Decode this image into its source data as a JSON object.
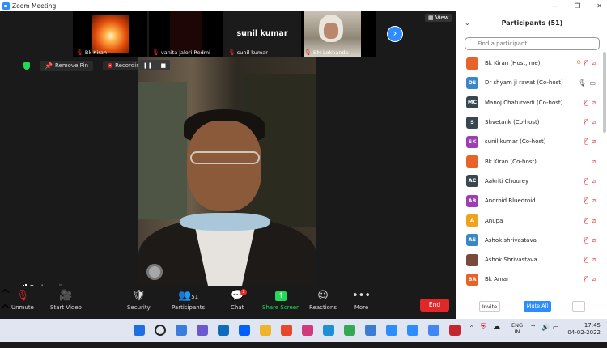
{
  "window": {
    "title": "Zoom Meeting",
    "controls": [
      "—",
      "❐",
      "✕"
    ]
  },
  "thumbnails": [
    {
      "name": "Bk Kiran"
    },
    {
      "name": "vanita jalori Redmi"
    },
    {
      "name": "sunil kumar",
      "display_name": "sunil kumar"
    },
    {
      "name": "BM Lokhande"
    }
  ],
  "view_label": "View",
  "next_arrow": "›",
  "top_left": {
    "remove_pin": "Remove Pin",
    "recording": "Recording..."
  },
  "pause_controls": {
    "pause": "❚❚",
    "stop": "■"
  },
  "active_speaker": "Dr shyam ji rawat",
  "toolbar": {
    "unmute": "Unmute",
    "start_video": "Start Video",
    "security": "Security",
    "participants": "Participants",
    "participants_count": "51",
    "chat": "Chat",
    "chat_badge": "2",
    "share_screen": "Share Screen",
    "reactions": "Reactions",
    "more": "More",
    "end": "End"
  },
  "panel": {
    "title": "Participants (51)",
    "search_placeholder": "Find a participant",
    "participants": [
      {
        "initials": "",
        "name": "Bk Kiran (Host, me)",
        "avatar_color": "#e8632a",
        "mic": "off",
        "cam": "off",
        "sharing": true
      },
      {
        "initials": "DS",
        "name": "Dr shyam ji rawat (Co-host)",
        "avatar_color": "#3a86c8",
        "mic": "on",
        "cam": "on"
      },
      {
        "initials": "MC",
        "name": "Manoj Chaturvedi (Co-host)",
        "avatar_color": "#37474f",
        "mic": "off",
        "cam": "off"
      },
      {
        "initials": "S",
        "name": "Shvetank (Co-host)",
        "avatar_color": "#37474f",
        "mic": "off",
        "cam": "off"
      },
      {
        "initials": "SK",
        "name": "sunil kumar (Co-host)",
        "avatar_color": "#9c3fb5",
        "mic": "off",
        "cam": "off"
      },
      {
        "initials": "",
        "name": "Bk Kiran (Co-host)",
        "avatar_color": "#e8632a",
        "mic": "none",
        "cam": "off"
      },
      {
        "initials": "AC",
        "name": "Aakriti Chourey",
        "avatar_color": "#37474f",
        "mic": "off",
        "cam": "off"
      },
      {
        "initials": "AB",
        "name": "Android Bluedroid",
        "avatar_color": "#9c3fb5",
        "mic": "off",
        "cam": "off"
      },
      {
        "initials": "A",
        "name": "Anupa",
        "avatar_color": "#f0a21b",
        "mic": "off",
        "cam": "off"
      },
      {
        "initials": "AS",
        "name": "Ashok shrivastava",
        "avatar_color": "#3a86c8",
        "mic": "off",
        "cam": "off"
      },
      {
        "initials": "",
        "name": "Ashok Shrivastava",
        "avatar_color": "#7a4a3a",
        "mic": "off",
        "cam": "off"
      },
      {
        "initials": "BA",
        "name": "Bk Amar",
        "avatar_color": "#e8632a",
        "mic": "off",
        "cam": "off"
      }
    ],
    "invite": "Invite",
    "mute_all": "Mute All",
    "more": "..."
  },
  "taskbar": {
    "lang_top": "ENG",
    "lang_bottom": "IN",
    "time": "17:45",
    "date": "04-02-2022",
    "app_colors": [
      "#1f6fe0",
      "#222222",
      "#3b7ddd",
      "#6a5acd",
      "#0f6cbd",
      "#0061fe",
      "#f0b429",
      "#e8472a",
      "#d13b7e",
      "#1f8fd8",
      "#34a853",
      "#3a7bd5",
      "#2d8cff",
      "#2d8cff",
      "#4285f4",
      "#c4262e"
    ]
  }
}
